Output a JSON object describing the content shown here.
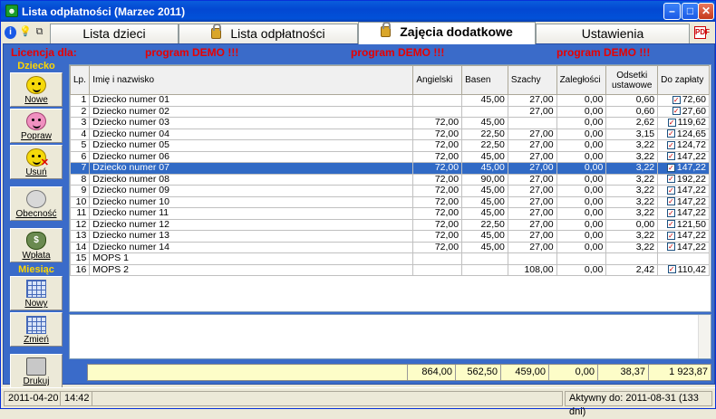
{
  "window": {
    "title": "Lista odpłatności (Marzec 2011)"
  },
  "tabs": [
    {
      "label": "Lista dzieci"
    },
    {
      "label": "Lista odpłatności"
    },
    {
      "label": "Zajęcia dodatkowe"
    },
    {
      "label": "Ustawienia"
    }
  ],
  "license": {
    "label": "Licencja dla:",
    "demo1": "program DEMO !!!",
    "demo2": "program DEMO !!!",
    "demo3": "program DEMO !!!"
  },
  "sidebar": {
    "section_child": "Dziecko",
    "section_month": "Miesiąc",
    "btn_new": "Nowe",
    "btn_edit": "Popraw",
    "btn_delete": "Usuń",
    "btn_attendance": "Obecność",
    "btn_payment": "Wpłata",
    "btn_month_new": "Nowy",
    "btn_month_change": "Zmień",
    "btn_print": "Drukuj"
  },
  "table": {
    "headers": [
      "Lp.",
      "Imię i nazwisko",
      "Angielski",
      "Basen",
      "Szachy",
      "Zaległości",
      "Odsetki ustawowe",
      "Do zapłaty"
    ],
    "rows": [
      [
        "1",
        "Dziecko numer 01",
        "",
        "45,00",
        "27,00",
        "0,00",
        "0,60",
        "72,60"
      ],
      [
        "2",
        "Dziecko numer 02",
        "",
        "",
        "27,00",
        "0,00",
        "0,60",
        "27,60"
      ],
      [
        "3",
        "Dziecko numer 03",
        "72,00",
        "45,00",
        "",
        "0,00",
        "2,62",
        "119,62"
      ],
      [
        "4",
        "Dziecko numer 04",
        "72,00",
        "22,50",
        "27,00",
        "0,00",
        "3,15",
        "124,65"
      ],
      [
        "5",
        "Dziecko numer 05",
        "72,00",
        "22,50",
        "27,00",
        "0,00",
        "3,22",
        "124,72"
      ],
      [
        "6",
        "Dziecko numer 06",
        "72,00",
        "45,00",
        "27,00",
        "0,00",
        "3,22",
        "147,22"
      ],
      [
        "7",
        "Dziecko numer 07",
        "72,00",
        "45,00",
        "27,00",
        "0,00",
        "3,22",
        "147,22"
      ],
      [
        "8",
        "Dziecko numer 08",
        "72,00",
        "90,00",
        "27,00",
        "0,00",
        "3,22",
        "192,22"
      ],
      [
        "9",
        "Dziecko numer 09",
        "72,00",
        "45,00",
        "27,00",
        "0,00",
        "3,22",
        "147,22"
      ],
      [
        "10",
        "Dziecko numer 10",
        "72,00",
        "45,00",
        "27,00",
        "0,00",
        "3,22",
        "147,22"
      ],
      [
        "11",
        "Dziecko numer 11",
        "72,00",
        "45,00",
        "27,00",
        "0,00",
        "3,22",
        "147,22"
      ],
      [
        "12",
        "Dziecko numer 12",
        "72,00",
        "22,50",
        "27,00",
        "0,00",
        "0,00",
        "121,50"
      ],
      [
        "13",
        "Dziecko numer 13",
        "72,00",
        "45,00",
        "27,00",
        "0,00",
        "3,22",
        "147,22"
      ],
      [
        "14",
        "Dziecko numer 14",
        "72,00",
        "45,00",
        "27,00",
        "0,00",
        "3,22",
        "147,22"
      ],
      [
        "15",
        "MOPS 1",
        "",
        "",
        "",
        "",
        "",
        ""
      ],
      [
        "16",
        "MOPS 2",
        "",
        "",
        "108,00",
        "0,00",
        "2,42",
        "110,42"
      ]
    ],
    "selected_index": 6,
    "checkbox_mark": "✓"
  },
  "totals": {
    "angielski": "864,00",
    "basen": "562,50",
    "szachy": "459,00",
    "zaleglosci": "0,00",
    "odsetki": "38,37",
    "do_zaplaty": "1 923,87"
  },
  "status": {
    "date": "2011-04-20",
    "time": "14:42",
    "active": "Aktywny do: 2011-08-31 (133 dni)"
  }
}
